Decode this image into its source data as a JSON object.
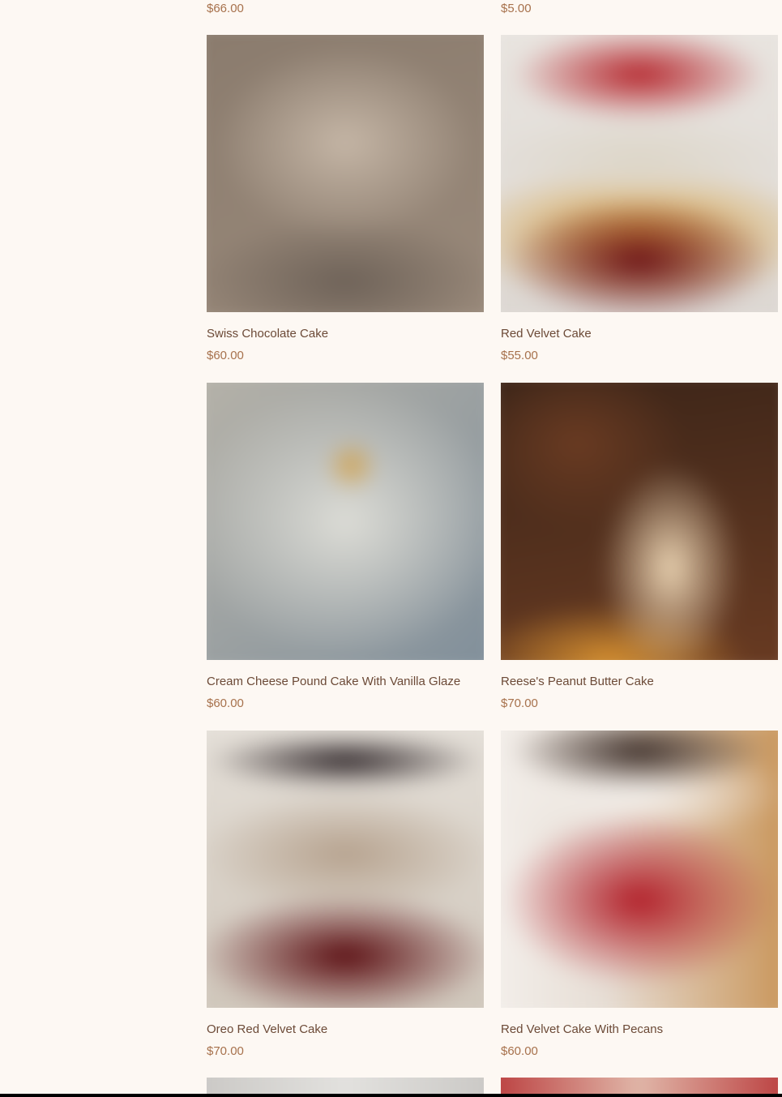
{
  "top_prices": [
    "$66.00",
    "$5.00"
  ],
  "products": [
    {
      "name": "Swiss Chocolate Cake",
      "price": "$60.00",
      "colors": [
        "#8a7b6d",
        "#c5b6a6",
        "#9a8a7b",
        "#6e6258"
      ]
    },
    {
      "name": "Red Velvet Cake",
      "price": "$55.00",
      "colors": [
        "#b5242b",
        "#ddd6c8",
        "#6d1317",
        "#d8a23e"
      ]
    },
    {
      "name": "Cream Cheese Pound Cake With Vanilla Glaze",
      "price": "$60.00",
      "colors": [
        "#dcdcd6",
        "#b7b3a9",
        "#d0a24f",
        "#7f8e9a"
      ]
    },
    {
      "name": "Reese's Peanut Butter Cake",
      "price": "$70.00",
      "colors": [
        "#6a3b22",
        "#e9d2b1",
        "#d79130",
        "#3a2418"
      ]
    },
    {
      "name": "Oreo Red Velvet Cake",
      "price": "$70.00",
      "colors": [
        "#b6a28e",
        "#5a0c10",
        "#2b2225",
        "#e5e0d9"
      ]
    },
    {
      "name": "Red Velvet Cake With Pecans",
      "price": "$60.00",
      "colors": [
        "#f4f0ec",
        "#b21e28",
        "#c89356",
        "#3b2c26"
      ]
    }
  ],
  "partial_colors": [
    "#c9c7c4",
    "#b9393a"
  ]
}
